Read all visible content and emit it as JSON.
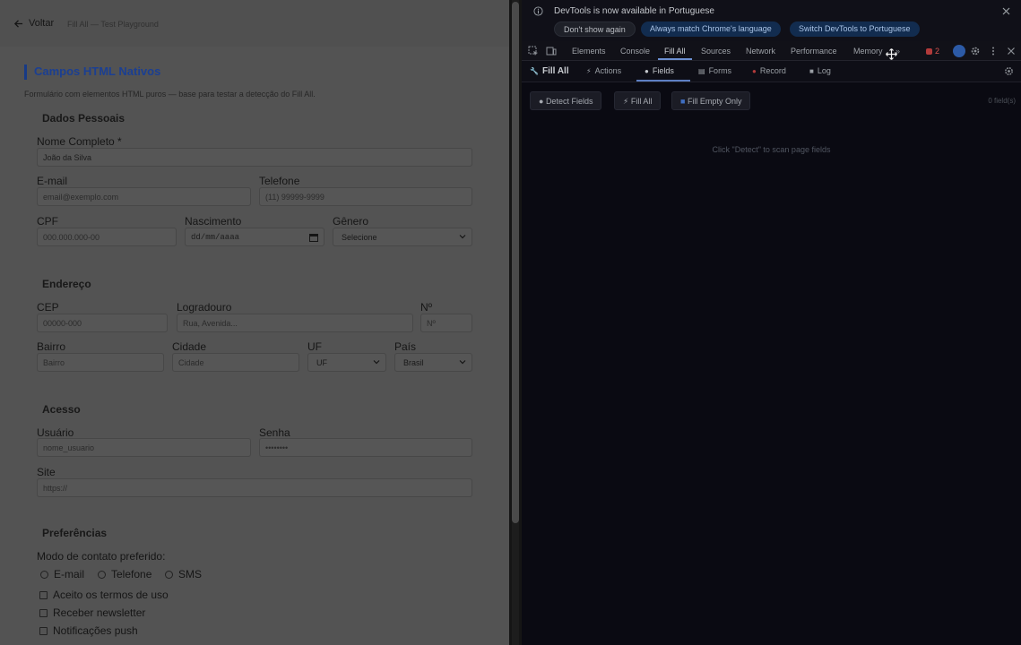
{
  "page": {
    "back_label": "Voltar",
    "breadcrumb": "Fill All — Test Playground",
    "title": "Campos HTML Nativos",
    "subtitle": "Formulário com elementos HTML puros — base para testar a detecção do Fill All.",
    "sections": {
      "personal": "Dados Pessoais",
      "address": "Endereço",
      "access": "Acesso",
      "preferences": "Preferências"
    },
    "fields": {
      "full_name": {
        "label": "Nome Completo *",
        "value": "João da Silva"
      },
      "email": {
        "label": "E-mail",
        "placeholder": "email@exemplo.com"
      },
      "phone": {
        "label": "Telefone",
        "placeholder": "(11) 99999-9999"
      },
      "cpf": {
        "label": "CPF",
        "placeholder": "000.000.000-00"
      },
      "birth": {
        "label": "Nascimento",
        "placeholder": "dd/mm/aaaa"
      },
      "gender": {
        "label": "Gênero",
        "value": "Selecione"
      },
      "cep": {
        "label": "CEP",
        "placeholder": "00000-000"
      },
      "street": {
        "label": "Logradouro",
        "placeholder": "Rua, Avenida..."
      },
      "number": {
        "label": "Nº",
        "placeholder": "Nº"
      },
      "district": {
        "label": "Bairro",
        "placeholder": "Bairro"
      },
      "city": {
        "label": "Cidade",
        "placeholder": "Cidade"
      },
      "state": {
        "label": "UF",
        "value": "UF"
      },
      "country": {
        "label": "País",
        "value": "Brasil"
      },
      "username": {
        "label": "Usuário",
        "placeholder": "nome_usuario"
      },
      "password": {
        "label": "Senha",
        "placeholder": "••••••••"
      },
      "site": {
        "label": "Site",
        "placeholder": "https://"
      }
    },
    "contact_mode_label": "Modo de contato preferido:",
    "contact_options": [
      "E-mail",
      "Telefone",
      "SMS"
    ],
    "checkboxes": [
      "Aceito os termos de uso",
      "Receber newsletter",
      "Notificações push"
    ]
  },
  "devtools": {
    "infobar": {
      "message": "DevTools is now available in Portuguese",
      "dont_show": "Don't show again",
      "match_language": "Always match Chrome's language",
      "switch_language": "Switch DevTools to Portuguese"
    },
    "tabs": [
      "Elements",
      "Console",
      "Fill All",
      "Sources",
      "Network",
      "Performance",
      "Memory"
    ],
    "active_tab": "Fill All",
    "more_tabs": "»",
    "error_count": "2",
    "panel": {
      "brand": "Fill All",
      "subtabs": [
        "Actions",
        "Fields",
        "Forms",
        "Record",
        "Log"
      ],
      "active_subtab": "Fields",
      "buttons": {
        "detect": "Detect Fields",
        "fill_all": "Fill All",
        "fill_empty": "Fill Empty Only"
      },
      "field_count": "0 field(s)",
      "empty_message": "Click \"Detect\" to scan page fields"
    }
  },
  "colors": {
    "accent_blue": "#1b3f92",
    "devtools_bg": "#0a0a12",
    "error_red": "#d9534f"
  }
}
